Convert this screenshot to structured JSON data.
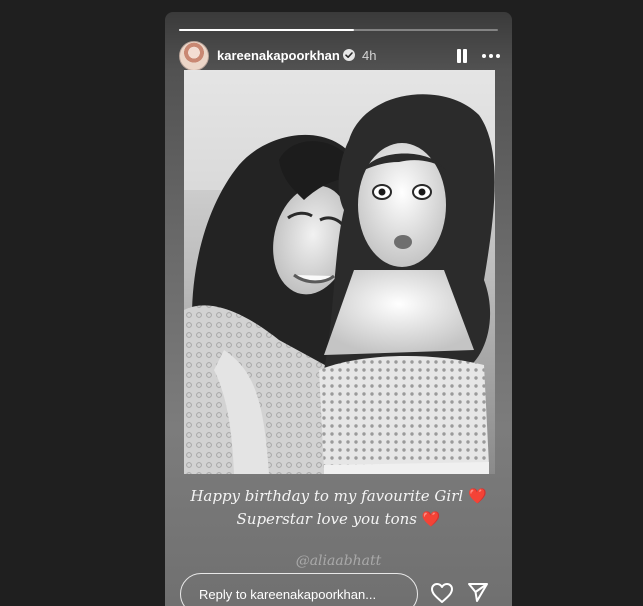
{
  "story": {
    "progress": 0.55,
    "header": {
      "username": "kareenakapoorkhan",
      "verified": true,
      "time": "4h"
    },
    "icons": {
      "avatar": "profile-avatar",
      "verified": "verified-badge-icon",
      "pause": "pause-icon",
      "more": "more-options-icon",
      "like": "heart-icon",
      "share": "send-icon"
    },
    "caption": {
      "line1": "Happy birthday to my favourite Girl",
      "line2": "Superstar love you tons",
      "emoji": "❤️"
    },
    "mention": "@aliaabhatt",
    "reply": {
      "placeholder": "Reply to kareenakapoorkhan..."
    }
  },
  "colors": {
    "background": "#1f1f1f",
    "text": "#ffffff",
    "heart": "#e0232e"
  }
}
